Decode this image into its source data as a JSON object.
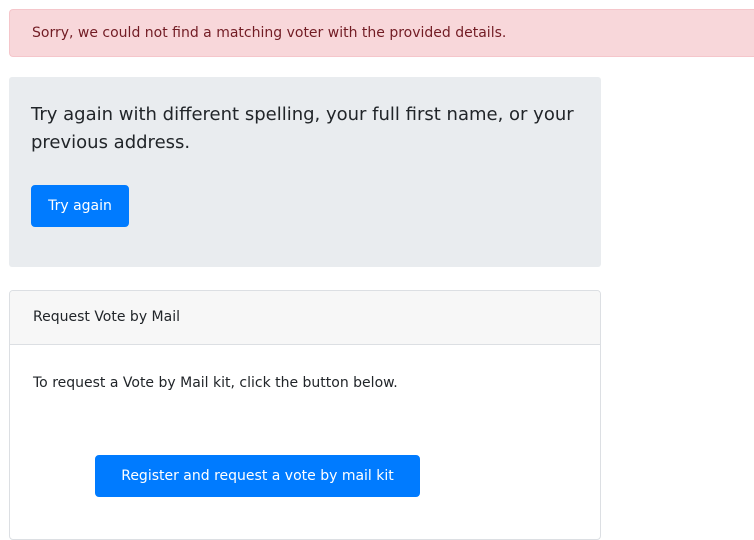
{
  "alert": {
    "message": "Sorry, we could not find a matching voter with the provided details."
  },
  "retry_panel": {
    "lead_text": "Try again with different spelling, your full first name, or your previous address.",
    "button_label": "Try again"
  },
  "vote_by_mail_card": {
    "header": "Request Vote by Mail",
    "body_text": "To request a Vote by Mail kit, click the button below.",
    "button_label": "Register and request a vote by mail kit"
  },
  "colors": {
    "primary": "#007bff",
    "alert_bg": "#f8d7da",
    "alert_text": "#721c24",
    "panel_bg": "#e9ecef"
  }
}
